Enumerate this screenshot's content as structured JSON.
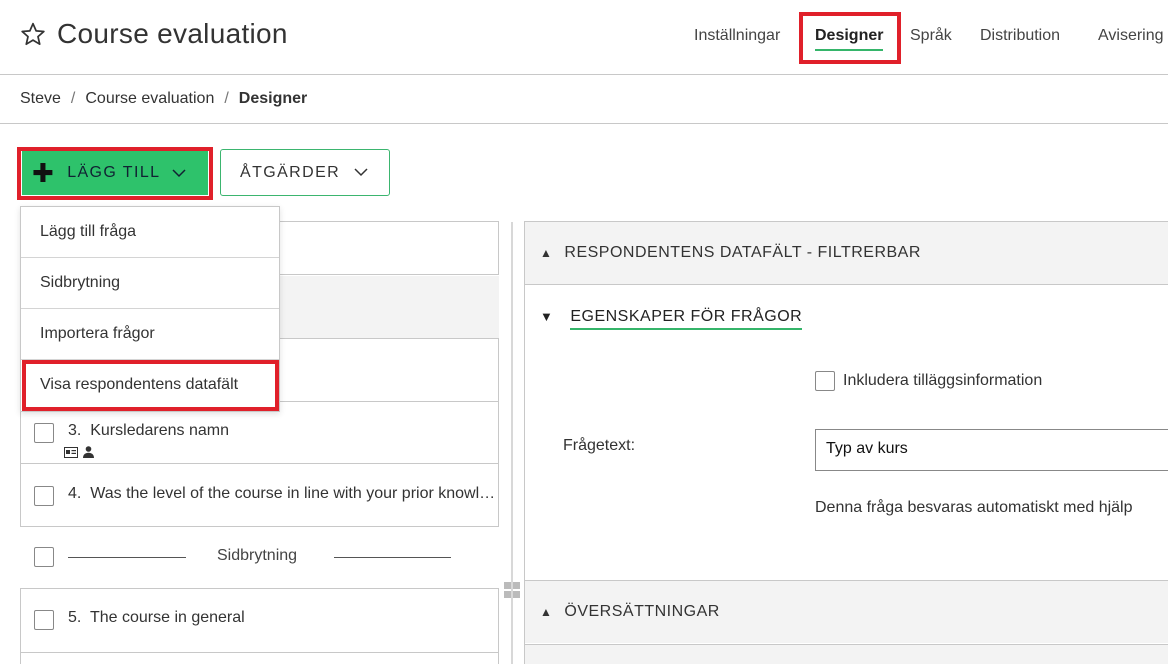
{
  "header": {
    "title": "Course evaluation",
    "star_icon": "star-outline-icon",
    "nav": [
      {
        "label": "Inställningar"
      },
      {
        "label": "Designer",
        "active": true
      },
      {
        "label": "Språk"
      },
      {
        "label": "Distribution"
      },
      {
        "label": "Avisering"
      }
    ]
  },
  "breadcrumb": {
    "items": [
      "Steve",
      "Course evaluation",
      "Designer"
    ],
    "separator": "/"
  },
  "toolbar": {
    "add_label": "LÄGG TILL",
    "actions_label": "ÅTGÄRDER",
    "accent_color": "#2ec26b",
    "highlight_color": "#e0202a"
  },
  "add_menu": {
    "items": [
      "Lägg till fråga",
      "Sidbrytning",
      "Importera frågor",
      "Visa respondentens datafält"
    ]
  },
  "questions": [
    {
      "number": "3.",
      "text": "Kursledarens namn"
    },
    {
      "number": "4.",
      "text": "Was the level of the course in line with your prior knowledge?"
    },
    {
      "number": "5.",
      "text": "The course in general"
    }
  ],
  "page_break": {
    "label": "Sidbrytning"
  },
  "properties": {
    "section_respondent": "RESPONDENTENS DATAFÄLT - FILTRERBAR",
    "section_questions": "EGENSKAPER FÖR FRÅGOR",
    "include_info_label": "Inkludera tilläggsinformation",
    "question_text_label": "Frågetext:",
    "question_text_value": "Typ av kurs",
    "help_text": "Denna fråga besvaras automatiskt med hjälp",
    "section_translations": "ÖVERSÄTTNINGAR"
  }
}
